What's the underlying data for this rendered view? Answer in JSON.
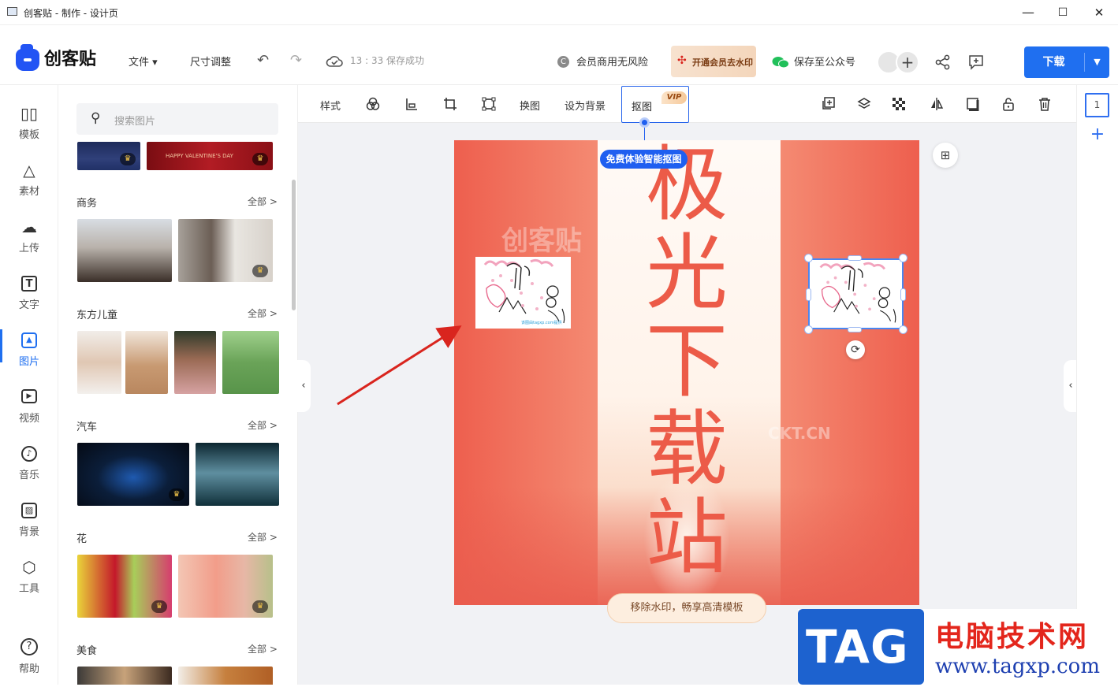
{
  "window": {
    "title": "创客贴 - 制作 - 设计页",
    "minimize": "—",
    "maximize": "☐",
    "close": "✕"
  },
  "topbar": {
    "logo_text": "创客贴",
    "file_menu": "文件 ▾",
    "resize": "尺寸调整",
    "undo_icon": "undo-icon",
    "redo_icon": "redo-icon",
    "save_status": "13 : 33 保存成功",
    "commercial": "会员商用无风险",
    "vip_watermark": "开通会员去水印",
    "save_wechat": "保存至公众号",
    "download": "下载",
    "accent": "#1f6ff0"
  },
  "leftnav": {
    "items": [
      {
        "label": "模板",
        "icon": "template-icon"
      },
      {
        "label": "素材",
        "icon": "elements-icon"
      },
      {
        "label": "上传",
        "icon": "upload-icon"
      },
      {
        "label": "文字",
        "icon": "text-icon"
      },
      {
        "label": "图片",
        "icon": "image-icon",
        "active": true
      },
      {
        "label": "视频",
        "icon": "video-icon"
      },
      {
        "label": "音乐",
        "icon": "music-icon"
      },
      {
        "label": "背景",
        "icon": "background-icon"
      },
      {
        "label": "工具",
        "icon": "tools-icon"
      },
      {
        "label": "帮助",
        "icon": "help-icon"
      }
    ]
  },
  "panel": {
    "search_placeholder": "搜索图片",
    "all_label": "全部  >",
    "categories": [
      "商务",
      "东方儿童",
      "汽车",
      "花",
      "美食"
    ],
    "banner_text": "HAPPY VALENTINE'S DAY"
  },
  "imagetoolbar": {
    "style": "样式",
    "replace": "换图",
    "set_bg": "设为背景",
    "cutout": "抠图",
    "vip": "VIP",
    "tip": "免费体验智能抠图"
  },
  "canvas": {
    "poster_chars": [
      "极",
      "光",
      "下",
      "载",
      "站"
    ],
    "watermark_logo": "创客贴",
    "watermark_url": "CKT.CN",
    "sticker_caption": "该图由tagxp.com提供",
    "remove_watermark": "移除水印，畅享高清模板"
  },
  "rightrail": {
    "page_number": "1",
    "add": "+"
  },
  "tag_logo": {
    "tag": "TAG",
    "cn": "电脑技术网",
    "url": "www.tagxp.com"
  }
}
